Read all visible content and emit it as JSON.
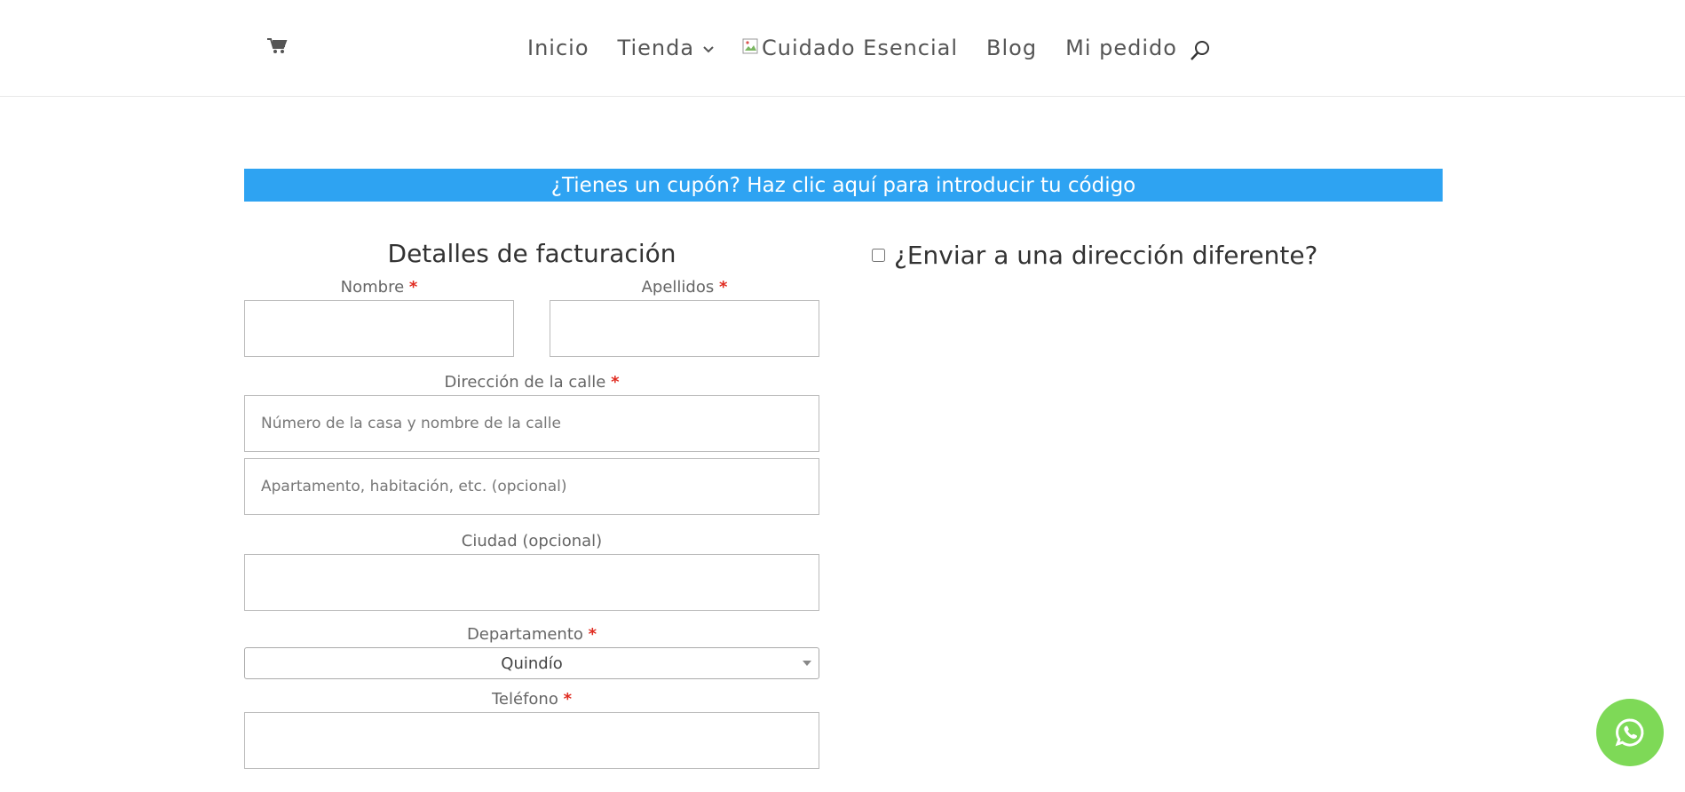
{
  "header": {
    "nav": {
      "inicio": "Inicio",
      "tienda": "Tienda",
      "logo_alt": "Cuidado Esencial",
      "blog": "Blog",
      "mi_pedido": "Mi pedido"
    },
    "icons": {
      "cart": "cart-icon",
      "chevron": "chevron-down-icon",
      "search": "search-icon"
    }
  },
  "coupon": {
    "text": "¿Tienes un cupón? Haz clic aquí para introducir tu código",
    "background": "#2ea3f2"
  },
  "billing": {
    "title": "Detalles de facturación",
    "required_mark": "*",
    "fields": {
      "nombre": {
        "label": "Nombre",
        "value": ""
      },
      "apellidos": {
        "label": "Apellidos",
        "value": ""
      },
      "direccion": {
        "label": "Dirección de la calle",
        "placeholder_1": "Número de la casa y nombre de la calle",
        "placeholder_2": "Apartamento, habitación, etc. (opcional)"
      },
      "ciudad": {
        "label": "Ciudad (opcional)",
        "value": ""
      },
      "departamento": {
        "label": "Departamento",
        "selected": "Quindío"
      },
      "telefono": {
        "label": "Teléfono",
        "value": ""
      }
    }
  },
  "shipping": {
    "label": "¿Enviar a una dirección diferente?",
    "checked": false
  },
  "whatsapp": {
    "icon": "whatsapp-icon",
    "color": "#7ed957"
  }
}
